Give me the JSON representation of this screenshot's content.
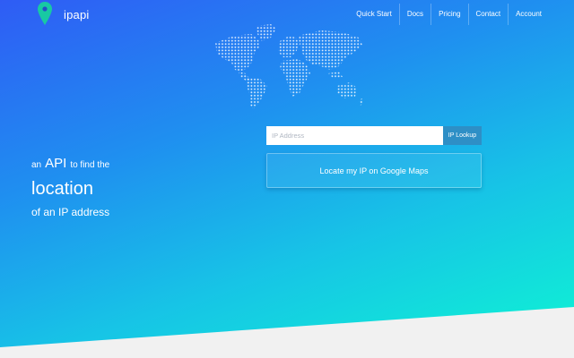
{
  "header": {
    "logo_icon": "map-pin-icon",
    "brand": "ipapi",
    "nav": [
      {
        "label": "Quick Start"
      },
      {
        "label": "Docs"
      },
      {
        "label": "Pricing"
      },
      {
        "label": "Contact"
      },
      {
        "label": "Account"
      }
    ]
  },
  "hero": {
    "map_icon": "world-map-dots",
    "lookup": {
      "placeholder": "IP Address",
      "value": "",
      "button_label": "IP Lookup"
    },
    "maps_button_label": "Locate my IP on Google Maps",
    "tagline": {
      "word1": "an",
      "word2": "API",
      "word3": "to find the",
      "line2": "location",
      "line3": "of an IP address"
    }
  },
  "colors": {
    "gradient_start": "#2f5cf5",
    "gradient_end": "#0ef7d2",
    "pin": "#18c9a3",
    "lookup_button": "#2e8fc6",
    "footer": "#f1f1f1"
  }
}
